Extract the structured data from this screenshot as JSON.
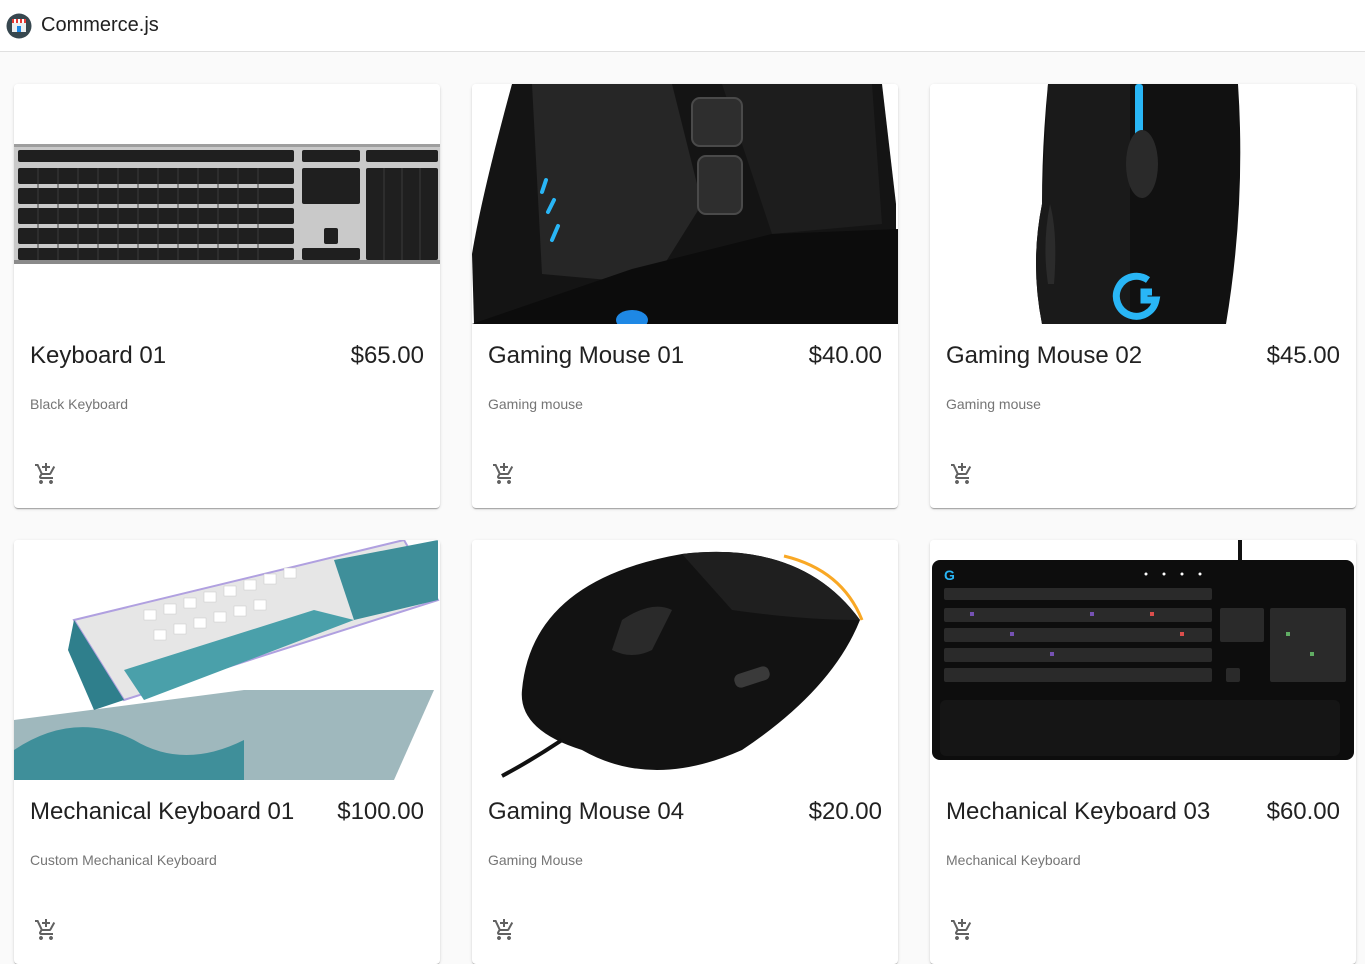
{
  "app": {
    "title": "Commerce.js"
  },
  "products": [
    {
      "name": "Keyboard 01",
      "price": "$65.00",
      "description": "Black Keyboard"
    },
    {
      "name": "Gaming Mouse 01",
      "price": "$40.00",
      "description": "Gaming mouse"
    },
    {
      "name": "Gaming Mouse 02",
      "price": "$45.00",
      "description": "Gaming mouse"
    },
    {
      "name": "Mechanical Keyboard 01",
      "price": "$100.00",
      "description": "Custom Mechanical Keyboard"
    },
    {
      "name": "Gaming Mouse 04",
      "price": "$20.00",
      "description": "Gaming Mouse"
    },
    {
      "name": "Mechanical Keyboard 03",
      "price": "$60.00",
      "description": "Mechanical Keyboard"
    }
  ],
  "icons": {
    "cart": "add-shopping-cart-icon",
    "logo": "store-logo-icon"
  }
}
